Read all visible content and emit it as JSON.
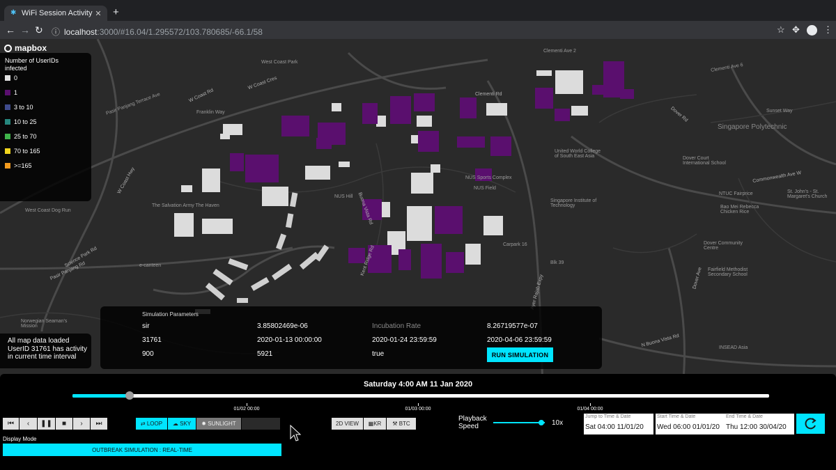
{
  "browser": {
    "tab_title": "WiFi Session Activity Dash",
    "url_host": "localhost",
    "url_rest": ":3000/#16.04/1.295572/103.780685/-66.1/58"
  },
  "map": {
    "logo": "mapbox",
    "labels": [
      "West Coast Park",
      "W Coast Rd",
      "W Coast Cres",
      "W Coast Hwy",
      "Franklin Way",
      "Buona Vista Rd",
      "West Coast Dog Run",
      "Pasir Panjang Rd",
      "Science Park Rd",
      "Pasir Panjang Terrace Ave",
      "The Salvation Army The Haven",
      "e-canteen",
      "NUS Hill",
      "NUS Sports Complex",
      "NUS Field",
      "Kent Ridge Rd",
      "Clementi Rd",
      "Clementi Ave 2",
      "Clementi Ave 6",
      "United World College of South East Asia",
      "Singapore Institute of Technology",
      "Singapore Polytechnic",
      "Dover Court International School",
      "Dover Rd",
      "Dover Community Centre",
      "Fairfield Methodist Secondary School",
      "N Buona Vista Rd",
      "INSEAD Asia",
      "Ayer Rajah Expy",
      "Commonwealth Ave W",
      "Carpark 16",
      "Blk 39",
      "Norwegian Seaman's Mission",
      "Bao Mei Rebecca Chicken Rice",
      "NTUC Fairprice",
      "St. John's - St. Margaret's Church",
      "Sunset Way",
      "Dover Ave"
    ]
  },
  "legend": {
    "title": "Number of UserIDs infected",
    "items": [
      {
        "label": "0",
        "color": "#e0e0e0"
      },
      {
        "label": "1",
        "color": "#5a0f6e"
      },
      {
        "label": "3 to 10",
        "color": "#3f4b8c"
      },
      {
        "label": "10 to 25",
        "color": "#26877e"
      },
      {
        "label": "25 to 70",
        "color": "#3fb44a"
      },
      {
        "label": "70 to 165",
        "color": "#f2d51e"
      },
      {
        "label": ">=165",
        "color": "#f29a1e"
      }
    ]
  },
  "status": {
    "text": "All map data loaded UserID 31761 has activity in current time interval"
  },
  "simulation": {
    "title": "Simulation Parameters",
    "rows": [
      [
        "sir",
        "3.85802469e-06",
        "Incubation Rate",
        "8.26719577e-07"
      ],
      [
        "31761",
        "2020-01-13 00:00:00",
        "2020-01-24 23:59:59",
        "2020-04-06 23:59:59"
      ],
      [
        "900",
        "5921",
        "true",
        ""
      ]
    ],
    "run_label": "RUN SIMULATION"
  },
  "timeline": {
    "current": "Saturday 4:00 AM 11 Jan 2020",
    "progress": 0.082,
    "ticks": [
      {
        "label": "01/02 00:00",
        "frac": 0.25
      },
      {
        "label": "01/03 00:00",
        "frac": 0.496
      },
      {
        "label": "01/04 00:00",
        "frac": 0.743
      }
    ]
  },
  "controls": {
    "toggles": {
      "loop": "LOOP",
      "sky": "SKY",
      "sunlight": "SUNLIGHT"
    },
    "view": {
      "mode2d": "2D VIEW",
      "kr": "KR",
      "btc": "BTC"
    },
    "playback_label": "Playback Speed",
    "speed": "10x",
    "speed_level": 0.93,
    "jump": {
      "label": "Jump to Time & Date",
      "value": "Sat 04:00 11/01/20"
    },
    "start": {
      "label": "Start Time & Date",
      "value": "Wed 06:00 01/01/20"
    },
    "end": {
      "label": "End Time & Date",
      "value": "Thu 12:00 30/04/20"
    },
    "display_mode_label": "Display Mode",
    "display_mode_value": "OUTBREAK SIMULATION : REAL-TIME"
  },
  "colors": {
    "accent": "#00e5ff",
    "infected": "#5a0f6e",
    "uninfected": "#e0e0e0"
  }
}
